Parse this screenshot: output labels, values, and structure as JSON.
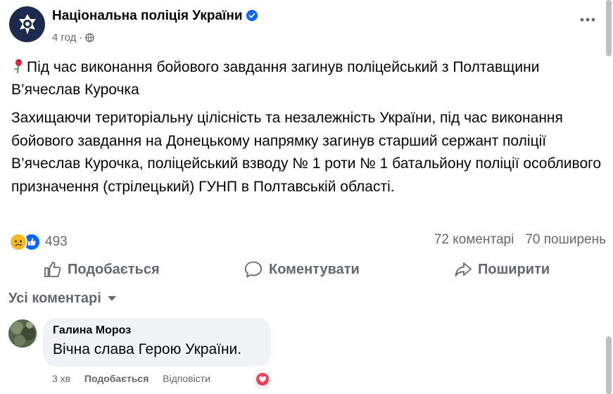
{
  "post": {
    "page_name": "Національна поліція України",
    "time": "4 год",
    "title": "Під час виконання бойового завдання загинув поліцейський з Полтавщини В’ячеслав Курочка",
    "body": "Захищаючи територіальну цілісність та незалежність України, під час виконання бойового завдання на Донецькому напрямку загинув старший сержант поліції В’ячеслав Курочка, поліцейський взводу № 1 роти № 1 батальйону поліції особливого призначення (стрілецький) ГУНП в Полтавській області."
  },
  "stats": {
    "reactions_count": "493",
    "comments": "72 коментарі",
    "shares": "70 поширень"
  },
  "actions": {
    "like": "Подобається",
    "comment": "Коментувати",
    "share": "Поширити"
  },
  "comments_filter": "Усі коментарі",
  "comment": {
    "author": "Галина Мороз",
    "text": "Вічна слава Герою України.",
    "time": "3 хв",
    "like": "Подобається",
    "reply": "Відповісти"
  },
  "colors": {
    "brand_blue": "#0866ff",
    "secondary_text": "#65676b",
    "comment_bubble": "#f0f2f5",
    "love_red": "#f33e58"
  },
  "icons": [
    "verified-icon",
    "globe-icon",
    "more-icon",
    "flower-icon",
    "sad-icon",
    "like-icon",
    "comment-icon",
    "share-icon",
    "chevron-down-icon",
    "love-icon"
  ]
}
